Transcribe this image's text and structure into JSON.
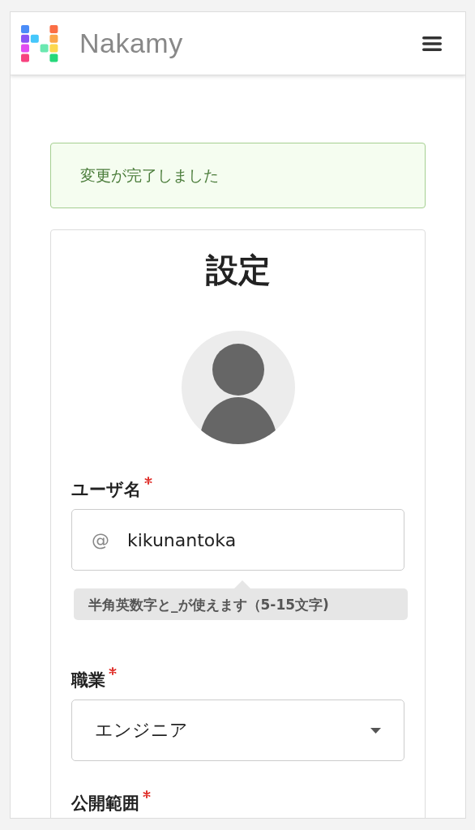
{
  "header": {
    "brand": "Nakamy"
  },
  "alert": {
    "message": "変更が完了しました"
  },
  "card": {
    "title": "設定"
  },
  "fields": [
    {
      "kind": "text",
      "label": "ユーザ名",
      "required": true,
      "prefix": "@",
      "value": "kikunantoka",
      "hint": "半角英数字と_が使えます（5-15文字)"
    },
    {
      "kind": "select",
      "label": "職業",
      "required": true,
      "value": "エンジニア"
    },
    {
      "kind": "cut",
      "label": "公開範囲",
      "required": true
    }
  ]
}
